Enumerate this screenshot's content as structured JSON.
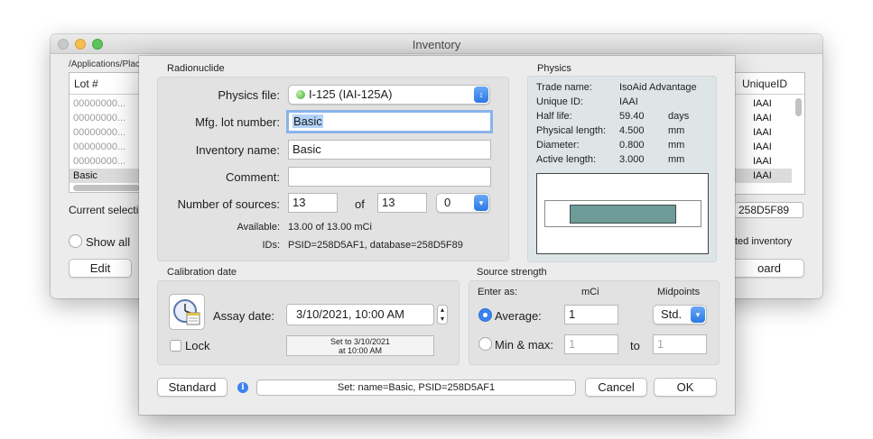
{
  "background_window": {
    "title": "Inventory",
    "path": "/Applications/Plac",
    "columns": [
      "Lot #",
      "UniqueID"
    ],
    "lot_rows": [
      "00000000...",
      "00000000...",
      "00000000...",
      "00000000...",
      "00000000...",
      "Basic"
    ],
    "uid_rows": [
      "IAAI",
      "IAAI",
      "IAAI",
      "IAAI",
      "IAAI",
      "IAAI"
    ],
    "current_selection_label": "Current selecti",
    "show_all_label": "Show all",
    "edit_button": "Edit",
    "uid_field": "258D5F89",
    "ted_inventory_label": "ted inventory",
    "board_button": "oard"
  },
  "radionuclide": {
    "group_title": "Radionuclide",
    "physics_file_label": "Physics file:",
    "physics_file_value": "I-125 (IAI-125A)",
    "mfg_lot_label": "Mfg. lot number:",
    "mfg_lot_value": "Basic",
    "inventory_name_label": "Inventory name:",
    "inventory_name_value": "Basic",
    "comment_label": "Comment:",
    "comment_value": "",
    "num_sources_label": "Number of sources:",
    "num_sources_value": "13",
    "of_label": "of",
    "of_value": "13",
    "num_popup_value": "0",
    "available_label": "Available:",
    "available_value": "13.00 of 13.00 mCi",
    "ids_label": "IDs:",
    "ids_value": "PSID=258D5AF1, database=258D5F89"
  },
  "physics": {
    "group_title": "Physics",
    "rows": [
      {
        "key": "Trade name:",
        "value": "IsoAid Advantage",
        "unit": ""
      },
      {
        "key": "Unique ID:",
        "value": "IAAI",
        "unit": ""
      },
      {
        "key": "Half life:",
        "value": "59.40",
        "unit": "days"
      },
      {
        "key": "Physical length:",
        "value": "4.500",
        "unit": "mm"
      },
      {
        "key": "Diameter:",
        "value": "0.800",
        "unit": "mm"
      },
      {
        "key": "Active length:",
        "value": "3.000",
        "unit": "mm"
      }
    ],
    "seed_color": "#6e9a98"
  },
  "calibration": {
    "group_title": "Calibration date",
    "assay_label": "Assay date:",
    "assay_value": "3/10/2021, 10:00 AM",
    "lock_label": "Lock",
    "set_to_line1": "Set to 3/10/2021",
    "set_to_line2": "at 10:00 AM"
  },
  "source_strength": {
    "group_title": "Source strength",
    "enter_as_label": "Enter as:",
    "unit_header": "mCi",
    "midpoints_header": "Midpoints",
    "average_label": "Average:",
    "average_value": "1",
    "midpoints_value": "Std.",
    "minmax_label": "Min & max:",
    "min_value": "1",
    "to_label": "to",
    "max_value": "1"
  },
  "footer": {
    "standard_button": "Standard",
    "status_text": "Set: name=Basic, PSID=258D5AF1",
    "cancel_button": "Cancel",
    "ok_button": "OK"
  },
  "colors": {
    "accent": "#3b82f0",
    "focus_ring": "#8ab3ea",
    "text_selection": "#b3d3fa",
    "physics_panel": "#dde5e6"
  }
}
